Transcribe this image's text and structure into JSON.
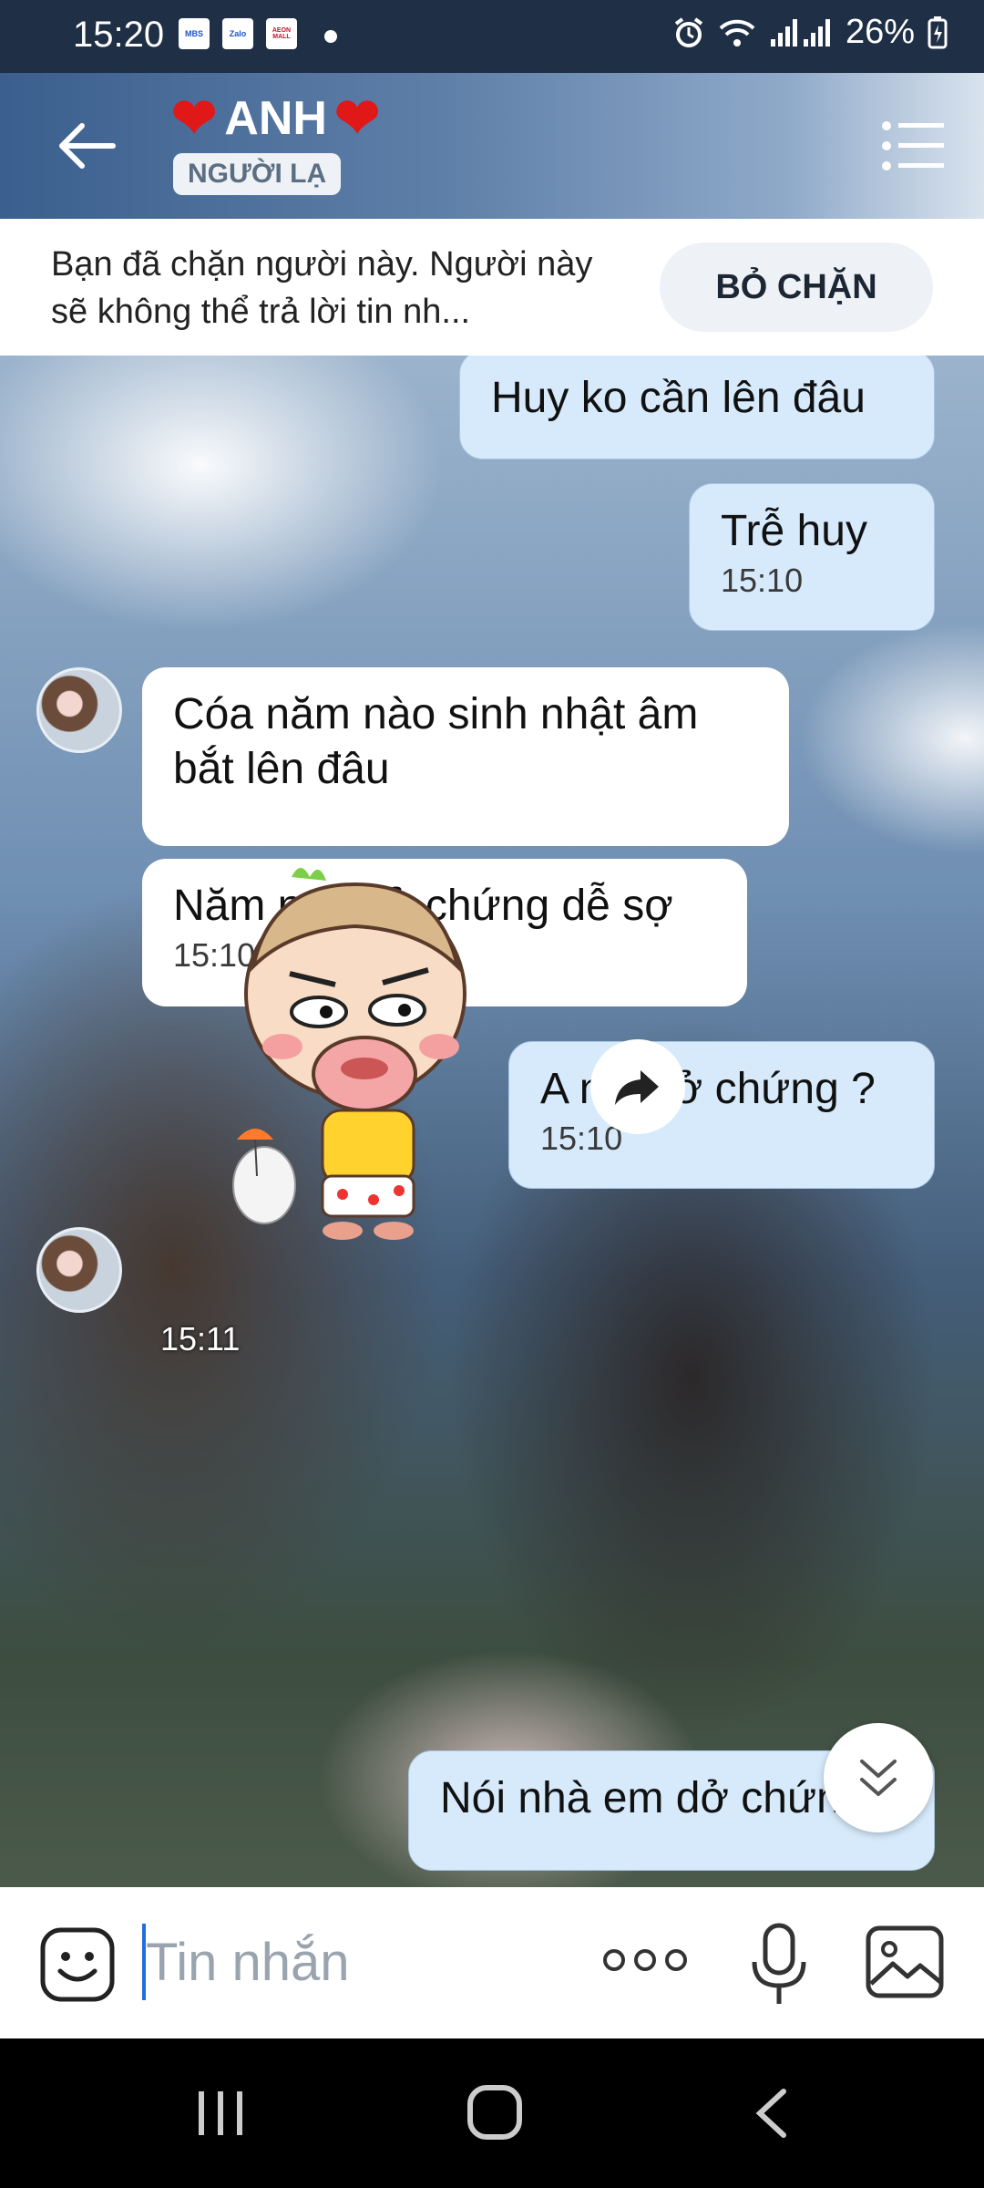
{
  "status_bar": {
    "time": "15:20",
    "apps": [
      "MBS",
      "Zalo",
      "AEON MALL"
    ],
    "battery": "26%",
    "icons": [
      "alarm-icon",
      "wifi-icon",
      "signal-icon",
      "battery-charging-icon"
    ]
  },
  "header": {
    "title": "ANH",
    "badge": "NGƯỜI LẠ",
    "heart_color": "#e01818"
  },
  "block_notice": {
    "text": "Bạn đã chặn người này. Người này sẽ không thể trả lời tin nh...",
    "button_label": "BỎ CHẶN"
  },
  "messages": [
    {
      "side": "out",
      "text": "Huy ko cần lên đâu",
      "time": ""
    },
    {
      "side": "out",
      "text": "Trễ huy",
      "time": "15:10"
    },
    {
      "side": "in",
      "text": "Cóa năm nào sinh nhật âm bắt lên đâu",
      "time": ""
    },
    {
      "side": "in",
      "text": "Năm nay dở chứng dễ sợ",
      "time": "15:10"
    },
    {
      "side": "out",
      "text": "A nói dở chứng ?",
      "time": "15:10"
    },
    {
      "side": "in",
      "type": "sticker",
      "time": "15:11"
    },
    {
      "side": "out",
      "text": "Nói nhà em dở chứng",
      "time": ""
    }
  ],
  "input": {
    "placeholder": "Tin nhắn"
  }
}
